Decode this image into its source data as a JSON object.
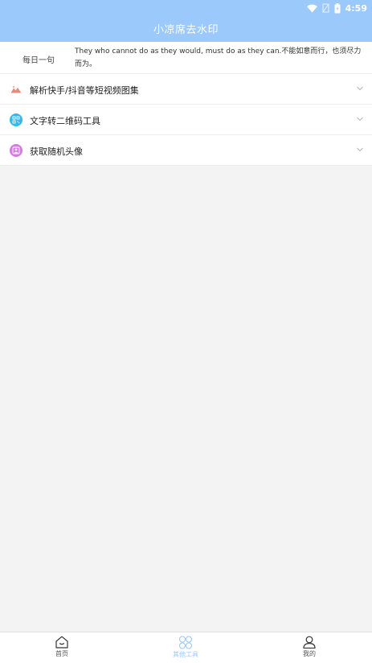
{
  "status_bar": {
    "time": "4:59"
  },
  "header": {
    "title": "小凉席去水印"
  },
  "daily_quote": {
    "label": "每日一句",
    "text": "They who cannot do as they would, must do as they can.不能如意而行，也须尽力而为。"
  },
  "tools": [
    {
      "label": "解析快手/抖音等短视频图集",
      "icon": "image-icon",
      "color": "#e88a7a"
    },
    {
      "label": "文字转二维码工具",
      "icon": "qrcode-icon",
      "color": "#35b9e6"
    },
    {
      "label": "获取随机头像",
      "icon": "portrait-icon",
      "color": "#d57be0"
    }
  ],
  "bottom_nav": [
    {
      "label": "首页",
      "icon": "home-icon",
      "active": false
    },
    {
      "label": "其他工具",
      "icon": "tools-icon",
      "active": true
    },
    {
      "label": "我的",
      "icon": "user-icon",
      "active": false
    }
  ],
  "colors": {
    "accent": "#9cc9fb",
    "background": "#f3f3f3"
  }
}
